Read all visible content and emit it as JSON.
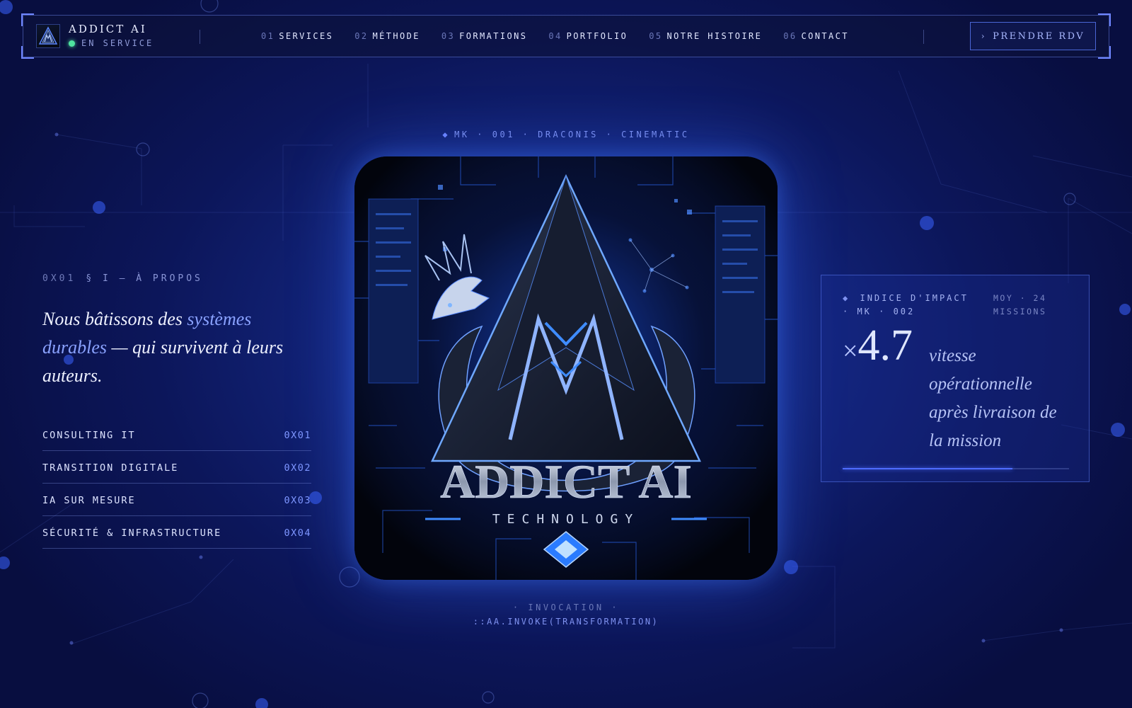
{
  "header": {
    "brand_name": "ADDICT AI",
    "status": "EN SERVICE",
    "nav": [
      {
        "num": "01",
        "label": "SERVICES"
      },
      {
        "num": "02",
        "label": "MÉTHODE"
      },
      {
        "num": "03",
        "label": "FORMATIONS"
      },
      {
        "num": "04",
        "label": "PORTFOLIO"
      },
      {
        "num": "05",
        "label": "NOTRE HISTOIRE"
      },
      {
        "num": "06",
        "label": "CONTACT"
      }
    ],
    "cta": {
      "arrow": "›",
      "label": "PRENDRE RDV"
    }
  },
  "about": {
    "section_num": "0X01",
    "section_label": "§ I — À PROPOS",
    "quote_before": "Nous bâtissons des ",
    "quote_highlight": "systèmes durables",
    "quote_after": " — qui survivent à leurs auteurs.",
    "services": [
      {
        "name": "CONSULTING IT",
        "code": "0X01"
      },
      {
        "name": "TRANSITION DIGITALE",
        "code": "0X02"
      },
      {
        "name": "IA SUR MESURE",
        "code": "0X03"
      },
      {
        "name": "SÉCURITÉ & INFRASTRUCTURE",
        "code": "0X04"
      }
    ]
  },
  "artwork": {
    "kicker": "MK · 001 · DRACONIS · CINEMATIC",
    "title": "ADDICT AI",
    "subtitle": "TECHNOLOGY",
    "invoke_label": "· INVOCATION ·",
    "invoke_code": "::AA.INVOKE(TRANSFORMATION)"
  },
  "impact": {
    "head_line1": "INDICE D'IMPACT",
    "head_line2": "· MK · 002",
    "meta_line1": "MOY · 24",
    "meta_line2": "MISSIONS",
    "multiplier_symbol": "×",
    "value": "4.7",
    "description": "vitesse opérationnelle après livraison de la mission",
    "progress": 0.75
  },
  "colors": {
    "accent": "#7f97ff",
    "status_dot": "#4fe3a0",
    "background": "#0c165a"
  }
}
